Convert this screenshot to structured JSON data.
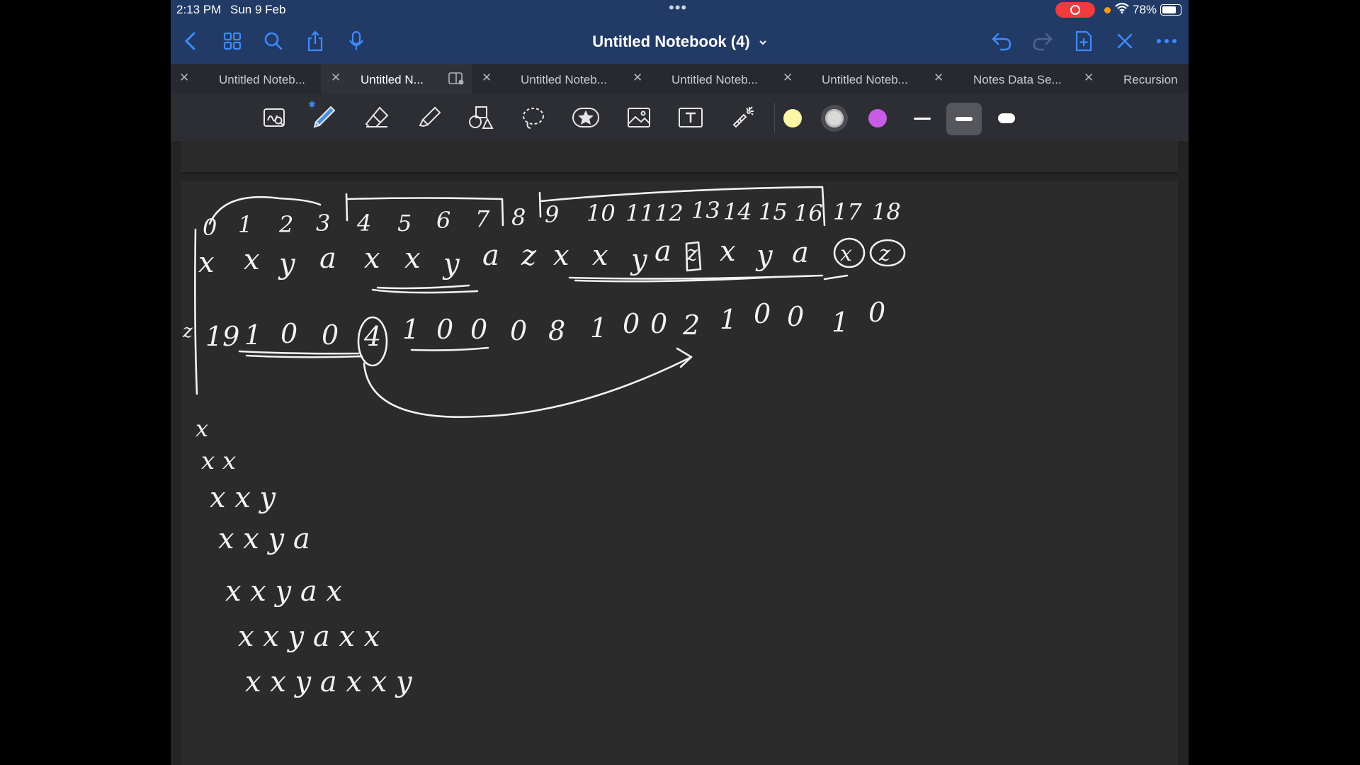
{
  "status_bar": {
    "time": "2:13 PM",
    "date": "Sun 9 Feb",
    "battery": "78%"
  },
  "navbar": {
    "title": "Untitled Notebook (4)"
  },
  "tabs": [
    {
      "label": "Untitled Noteb..."
    },
    {
      "label": "Untitled N..."
    },
    {
      "label": "Untitled Noteb..."
    },
    {
      "label": "Untitled Noteb..."
    },
    {
      "label": "Untitled Noteb..."
    },
    {
      "label": "Notes Data Se..."
    },
    {
      "label": "Recursion"
    }
  ],
  "toolbar": {
    "tools": [
      "zoom-window",
      "pen",
      "eraser",
      "highlighter",
      "shapes",
      "lasso",
      "stickers",
      "image",
      "text",
      "laser-pointer"
    ],
    "colors": [
      "#fdf6a8",
      "#d9d9d9",
      "#c85ce6"
    ],
    "selected_color": "#d9d9d9",
    "selected_stroke": "medium"
  },
  "notes": {
    "index_row": [
      "0",
      "1",
      "2",
      "3",
      "4",
      "5",
      "6",
      "7",
      "8",
      "9",
      "10",
      "11",
      "12",
      "13",
      "14",
      "15",
      "16",
      "17",
      "18"
    ],
    "string_row": [
      "x",
      "x",
      "y",
      "a",
      "x",
      "x",
      "y",
      "a",
      "z",
      "x",
      "x",
      "y",
      "a",
      "z",
      "x",
      "y",
      "a",
      "x",
      "z"
    ],
    "count_row": [
      "19",
      "1",
      "0",
      "0",
      "4",
      "1",
      "0",
      "0",
      "0",
      "8",
      "1",
      "0",
      "0",
      "2",
      "1",
      "0",
      "0",
      "1",
      "0"
    ],
    "row_marker": "z",
    "pyramid": [
      "x",
      "x x",
      "x x y",
      "x x y a",
      "x x y a x",
      "x x y a x x",
      "x x y a x x y"
    ]
  }
}
